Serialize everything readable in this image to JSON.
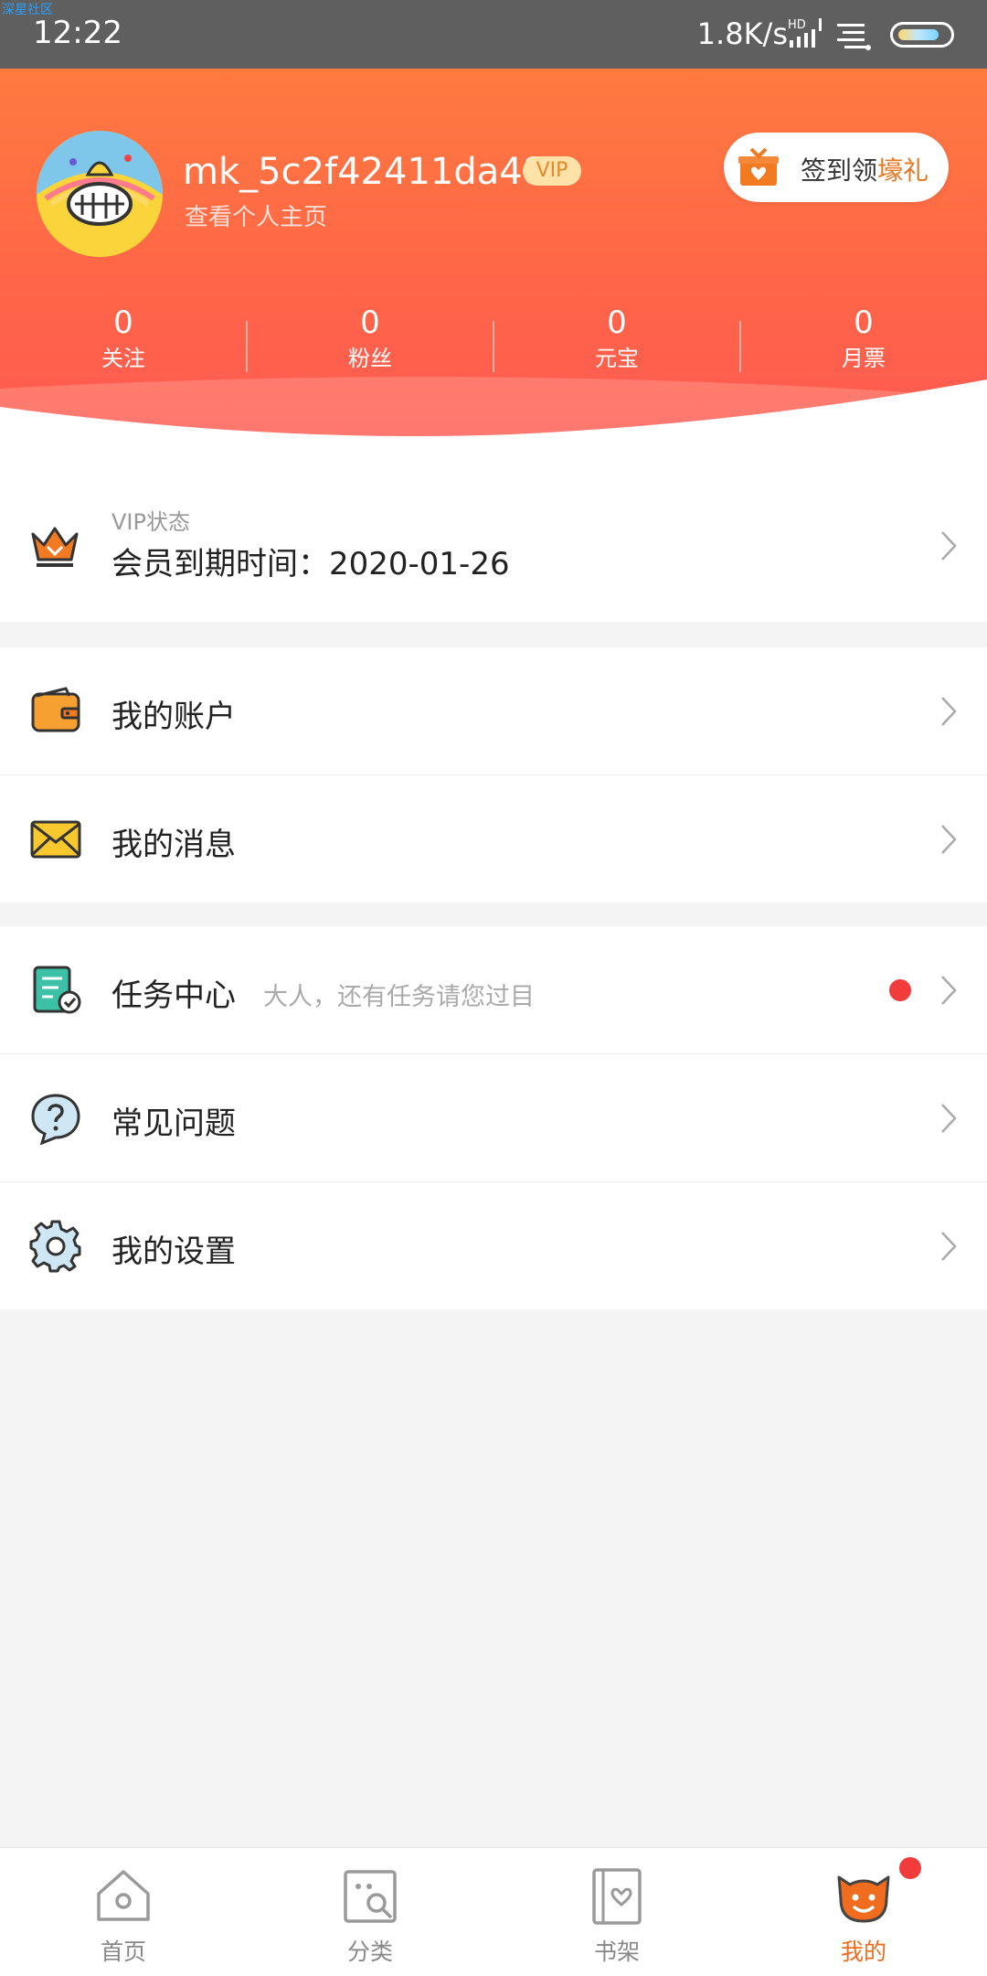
{
  "statusbar": {
    "watermark": "深星社区",
    "time": "12:22",
    "net_speed": "1.8K/s"
  },
  "profile": {
    "username": "mk_5c2f42411da48",
    "vip_badge": "VIP",
    "profile_link": "查看个人主页",
    "signin_prefix": "签到领",
    "signin_highlight": "壕礼"
  },
  "stats": [
    {
      "value": "0",
      "label": "关注"
    },
    {
      "value": "0",
      "label": "粉丝"
    },
    {
      "value": "0",
      "label": "元宝"
    },
    {
      "value": "0",
      "label": "月票"
    }
  ],
  "vip_status": {
    "caption": "VIP状态",
    "expiry": "会员到期时间：2020-01-26"
  },
  "menu_group1": [
    {
      "label": "我的账户",
      "icon": "wallet-icon"
    },
    {
      "label": "我的消息",
      "icon": "envelope-icon"
    }
  ],
  "menu_group2": [
    {
      "label": "任务中心",
      "sub": "大人，还有任务请您过目",
      "icon": "task-icon",
      "has_dot": true
    },
    {
      "label": "常见问题",
      "icon": "question-icon"
    },
    {
      "label": "我的设置",
      "icon": "gear-icon"
    }
  ],
  "tabs": [
    {
      "label": "首页",
      "icon": "home-icon",
      "active": false
    },
    {
      "label": "分类",
      "icon": "category-icon",
      "active": false
    },
    {
      "label": "书架",
      "icon": "bookshelf-icon",
      "active": false
    },
    {
      "label": "我的",
      "icon": "profile-cat-icon",
      "active": true
    }
  ],
  "colors": {
    "accent": "#f06c1e",
    "header_top": "#ff7a3f",
    "header_bottom": "#ff5854",
    "badge_red": "#f23b3b"
  }
}
